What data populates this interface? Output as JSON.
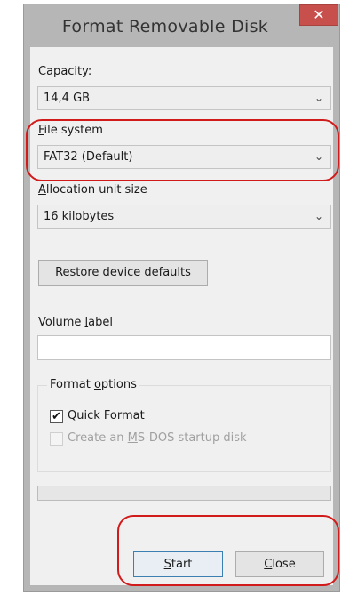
{
  "window": {
    "title": "Format Removable Disk",
    "close_glyph": "✕"
  },
  "capacity": {
    "label_pre": "Ca",
    "label_key": "p",
    "label_post": "acity:",
    "value": "14,4 GB"
  },
  "file_system": {
    "label_pre": "",
    "label_key": "F",
    "label_post": "ile system",
    "value": "FAT32 (Default)"
  },
  "allocation": {
    "label_pre": "",
    "label_key": "A",
    "label_post": "llocation unit size",
    "value": "16 kilobytes"
  },
  "restore_button": {
    "pre": "Restore ",
    "key": "d",
    "post": "evice defaults"
  },
  "volume_label": {
    "pre": "Volume ",
    "key": "l",
    "post": "abel",
    "value": ""
  },
  "format_options": {
    "legend_pre": "Format ",
    "legend_key": "o",
    "legend_post": "ptions",
    "quick_format": {
      "label": "Quick Format",
      "checked": true,
      "check_glyph": "✔"
    },
    "msdos": {
      "pre": "Create an ",
      "key": "M",
      "post": "S-DOS startup disk",
      "checked": false
    }
  },
  "progress": {
    "fraction": 0.0
  },
  "buttons": {
    "start": {
      "key": "S",
      "post": "tart"
    },
    "close": {
      "key": "C",
      "post": "lose"
    }
  },
  "dropdown_arrow": "⌄",
  "colors": {
    "annotation": "#d11a1a",
    "title_close_bg": "#c7504d",
    "window_frame": "#b6b6b6",
    "client_bg": "#f0f0f0"
  }
}
